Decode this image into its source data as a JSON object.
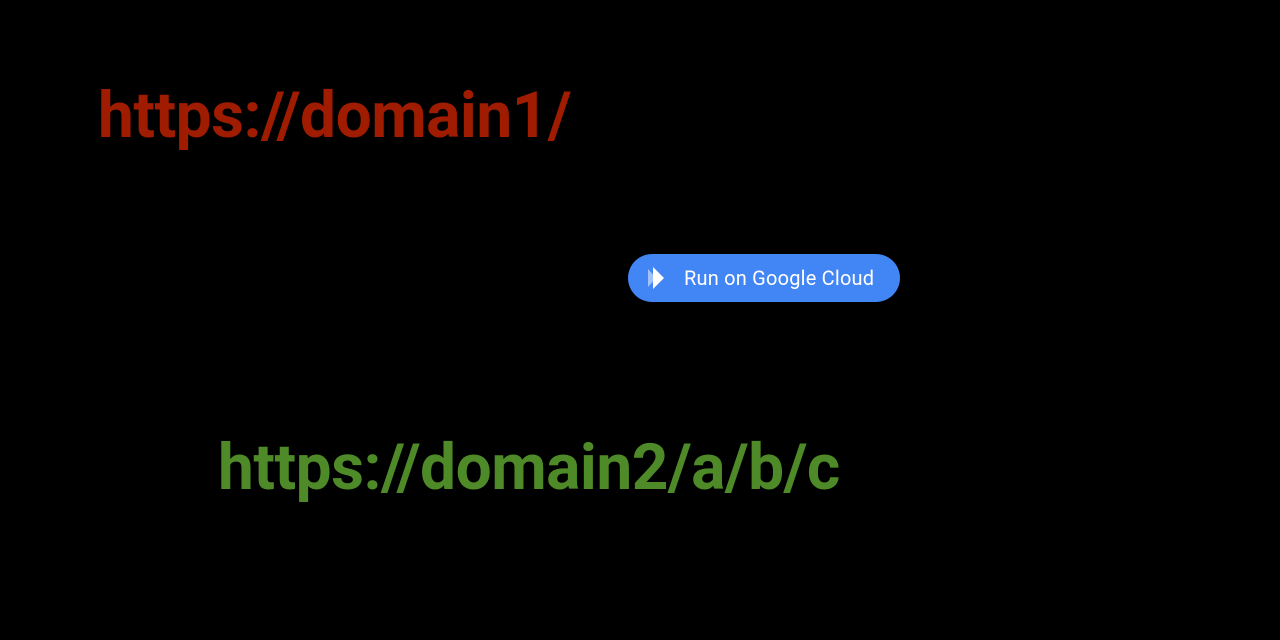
{
  "urls": {
    "primary": "https://domain1/",
    "secondary": "https://domain2/a/b/c"
  },
  "button": {
    "run_label": "Run on Google Cloud"
  },
  "colors": {
    "url_primary": "#a01c00",
    "url_secondary": "#4e8b28",
    "button_bg": "#4285f4",
    "button_fg": "#ffffff",
    "background": "#000000"
  }
}
